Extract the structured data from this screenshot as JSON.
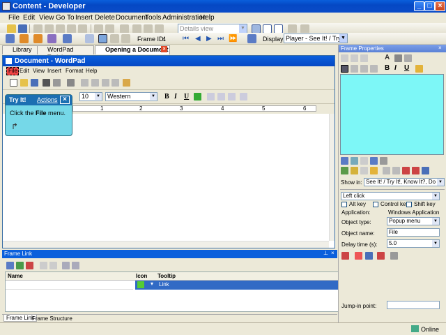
{
  "window": {
    "title": "Content - Developer"
  },
  "menu": [
    "File",
    "Edit",
    "View",
    "Go To",
    "Insert",
    "Delete",
    "Document",
    "Tools",
    "Administration",
    "Help"
  ],
  "toolbar": {
    "view_combo": "Details view",
    "frame_id_label": "Frame ID:",
    "frame_id_value": "4",
    "display_label": "Display:",
    "display_value": "Player - See It! / Try It!"
  },
  "tabs": [
    {
      "label": "Library"
    },
    {
      "label": "WordPad Training"
    },
    {
      "label": "Opening a Document"
    }
  ],
  "wordpad": {
    "title": "Document - WordPad",
    "menu": [
      "File",
      "Edit",
      "View",
      "Insert",
      "Format",
      "Help"
    ],
    "font_size": "10",
    "script": "Western",
    "format_buttons": [
      "B",
      "I",
      "U"
    ],
    "ruler_marks": [
      "1",
      "2",
      "3",
      "4",
      "5",
      "6"
    ]
  },
  "tryit": {
    "title": "Try It!",
    "actions": "Actions",
    "text_pre": "Click the ",
    "text_bold": "File",
    "text_post": " menu."
  },
  "frame_link": {
    "panel_title": "Frame Link",
    "columns": [
      "Name",
      "Icon",
      "Tooltip"
    ],
    "row": {
      "tooltip": "Link"
    },
    "bottom_tabs": [
      "Frame Link",
      "Frame Structure"
    ]
  },
  "frame_properties": {
    "panel_title": "Frame Properties",
    "preview_color": "#7df7f7",
    "show_in_label": "Show in:",
    "show_in_value": "See It! / Try It!, Know It?, Do It!",
    "action_value": "Left click",
    "checks": [
      "Alt key",
      "Control key",
      "Shift key"
    ],
    "application_label": "Application:",
    "application_value": "Windows Application",
    "object_type_label": "Object type:",
    "object_type_value": "Popup menu",
    "object_name_label": "Object name:",
    "object_name_value": "File",
    "delay_label": "Delay time (s):",
    "delay_value": "5.0",
    "jumpin_label": "Jump-in point:"
  },
  "status": {
    "online": "Online"
  }
}
